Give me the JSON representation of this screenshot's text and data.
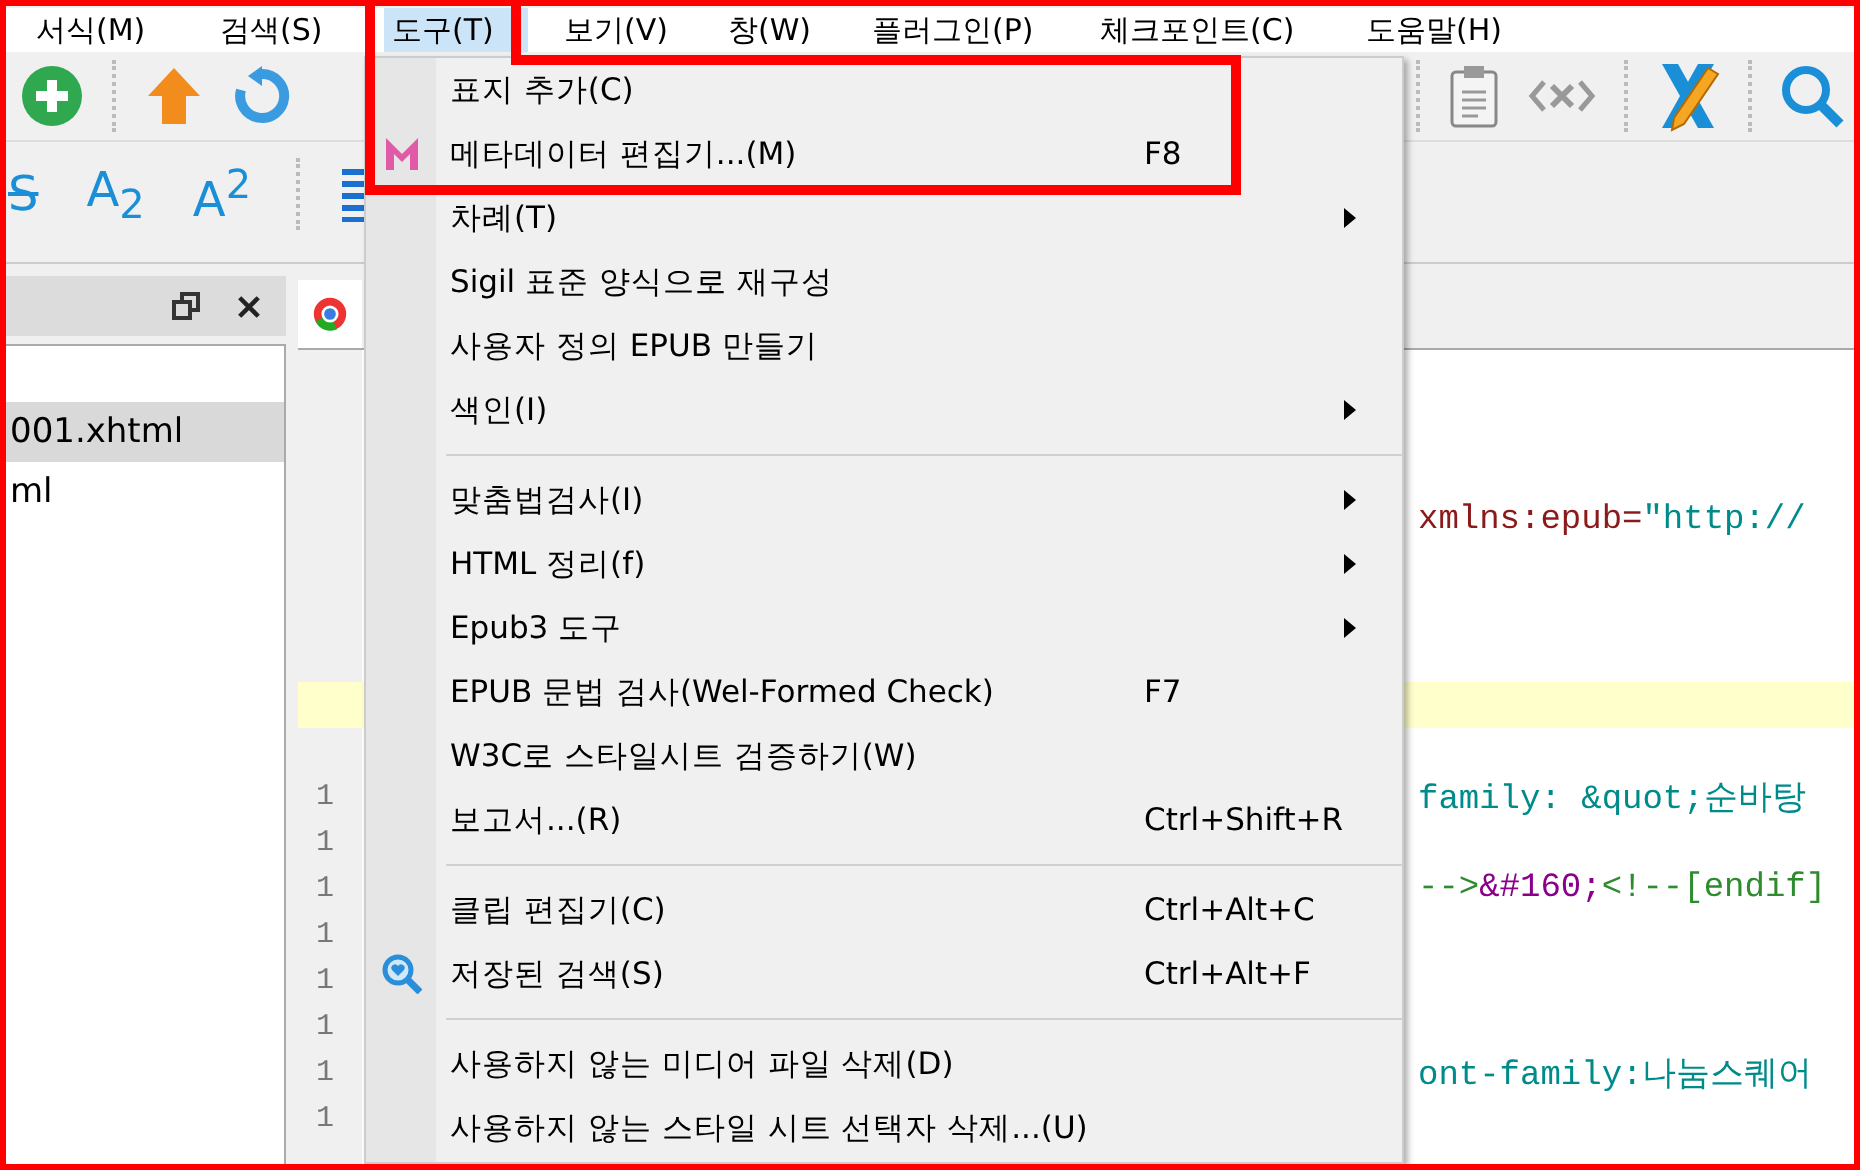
{
  "menubar": [
    {
      "label": "서식(M)",
      "selected": false
    },
    {
      "label": "검색(S)",
      "selected": false
    },
    {
      "label": "도구(T)",
      "selected": true
    },
    {
      "label": "보기(V)",
      "selected": false
    },
    {
      "label": "창(W)",
      "selected": false
    },
    {
      "label": "플러그인(P)",
      "selected": false
    },
    {
      "label": "체크포인트(C)",
      "selected": false
    },
    {
      "label": "도움말(H)",
      "selected": false
    }
  ],
  "toolbar_top": {
    "left": [
      {
        "kind": "add"
      },
      {
        "kind": "sep"
      },
      {
        "kind": "up"
      },
      {
        "kind": "refresh"
      }
    ],
    "right": [
      {
        "kind": "sep"
      },
      {
        "kind": "clipboard"
      },
      {
        "kind": "code"
      },
      {
        "kind": "sep"
      },
      {
        "kind": "x-pencil"
      },
      {
        "kind": "sep"
      },
      {
        "kind": "search"
      }
    ]
  },
  "toolbar_format": [
    {
      "kind": "strike",
      "label": "S"
    },
    {
      "kind": "text",
      "label": "A$_{2}$"
    },
    {
      "kind": "text",
      "label": "A$^{2}$"
    },
    {
      "kind": "sep"
    },
    {
      "kind": "align"
    }
  ],
  "file_panel": {
    "items": [
      {
        "label": "001.xhtml",
        "selected": true
      },
      {
        "label": "ml",
        "selected": false
      }
    ]
  },
  "editor": {
    "lines": [
      {
        "current": false
      },
      {
        "current": false
      },
      {
        "current": false
      },
      {
        "current": false,
        "tokens": [
          {
            "kind": "attr",
            "text": "xmlns:epub="
          },
          {
            "kind": "value",
            "text": "\"http://"
          }
        ]
      },
      {
        "current": false
      },
      {
        "current": false
      },
      {
        "current": false
      },
      {
        "current": true
      },
      {
        "current": false
      },
      {
        "current": false,
        "number": "1",
        "tokens": [
          {
            "kind": "value",
            "text": "family: &quot;순바탕"
          }
        ]
      },
      {
        "current": false,
        "number": "1"
      },
      {
        "current": false,
        "number": "1",
        "tokens": [
          {
            "kind": "comment",
            "text": "-->"
          },
          {
            "kind": "entity",
            "text": "&#160;"
          },
          {
            "kind": "comment",
            "text": "<!--[endif]"
          }
        ]
      },
      {
        "current": false,
        "number": "1"
      },
      {
        "current": false,
        "number": "1"
      },
      {
        "current": false,
        "number": "1"
      },
      {
        "current": false,
        "number": "1",
        "tokens": [
          {
            "kind": "value",
            "text": "ont-family:나눔스퀘어"
          }
        ]
      },
      {
        "current": false,
        "number": "1"
      }
    ]
  },
  "tools_menu": [
    {
      "kind": "item",
      "label": "표지 추가(C)",
      "submenu": false
    },
    {
      "kind": "item",
      "label": "메타데이터 편집기...(M)",
      "shortcut": "F8",
      "submenu": false
    },
    {
      "kind": "item",
      "label": "차례(T)",
      "submenu": true
    },
    {
      "kind": "item",
      "label": "Sigil 표준 양식으로 재구성",
      "submenu": false
    },
    {
      "kind": "item",
      "label": "사용자 정의 EPUB 만들기",
      "submenu": false
    },
    {
      "kind": "item",
      "label": "색인(I)",
      "submenu": true
    },
    {
      "kind": "separator"
    },
    {
      "kind": "item",
      "label": "맞춤법검사(I)",
      "submenu": true
    },
    {
      "kind": "item",
      "label": "HTML 정리(f)",
      "submenu": true
    },
    {
      "kind": "item",
      "label": "Epub3 도구",
      "submenu": true
    },
    {
      "kind": "item",
      "label": "EPUB 문법 검사(Wel-Formed Check)",
      "shortcut": "F7",
      "submenu": false
    },
    {
      "kind": "item",
      "label": "W3C로 스타일시트 검증하기(W)",
      "submenu": false
    },
    {
      "kind": "item",
      "label": "보고서...(R)",
      "shortcut": "Ctrl+Shift+R",
      "submenu": false
    },
    {
      "kind": "separator"
    },
    {
      "kind": "item",
      "label": "클립 편집기(C)",
      "shortcut": "Ctrl+Alt+C",
      "submenu": false
    },
    {
      "kind": "item",
      "label": "저장된 검색(S)",
      "shortcut": "Ctrl+Alt+F",
      "submenu": false
    },
    {
      "kind": "separator"
    },
    {
      "kind": "item",
      "label": "사용하지 않는 미디어 파일 삭제(D)",
      "submenu": false
    },
    {
      "kind": "item",
      "label": "사용하지 않는 스타일 시트 선택자 삭제...(U)",
      "submenu": false
    }
  ]
}
